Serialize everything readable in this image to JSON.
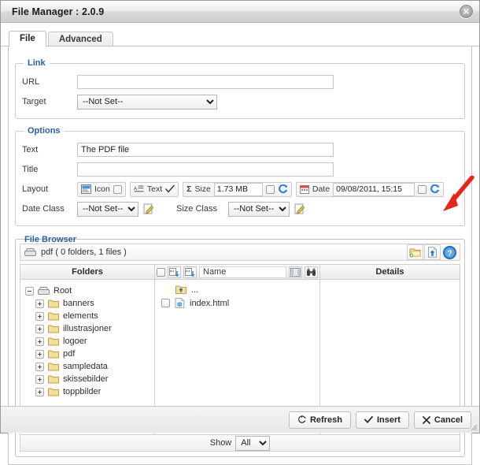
{
  "window": {
    "title": "File Manager : 2.0.9",
    "close_icon": "close-circle-icon"
  },
  "tabs": [
    {
      "label": "File",
      "active": true
    },
    {
      "label": "Advanced",
      "active": false
    }
  ],
  "link_section": {
    "legend": "Link",
    "url_label": "URL",
    "url_value": "",
    "target_label": "Target",
    "target_value": "--Not Set--",
    "target_options": [
      "--Not Set--"
    ]
  },
  "options_section": {
    "legend": "Options",
    "text_label": "Text",
    "text_value": "The PDF file",
    "title_label": "Title",
    "title_value": "",
    "layout_label": "Layout",
    "layout": {
      "icon_label": "Icon",
      "icon_checked": false,
      "text_label": "Text",
      "text_checked": true,
      "size_label": "Size",
      "size_value": "1.73 MB",
      "size_checked": false,
      "size_refresh_icon": "refresh-icon",
      "date_label": "Date",
      "date_value": "09/08/2011, 15:15",
      "date_checked": false,
      "date_refresh_icon": "refresh-icon"
    },
    "date_class_label": "Date Class",
    "date_class_value": "--Not Set--",
    "date_class_edit_icon": "edit-pencil-icon",
    "size_class_label": "Size Class",
    "size_class_value": "--Not Set--",
    "size_class_edit_icon": "edit-pencil-icon",
    "class_options": [
      "--Not Set--"
    ]
  },
  "file_browser": {
    "legend": "File Browser",
    "path_icon": "drive-icon",
    "path_text": "pdf ( 0 folders, 1 files )",
    "toolbar_buttons": [
      {
        "name": "new-folder-button",
        "icon": "folder-add-icon"
      },
      {
        "name": "upload-button",
        "icon": "upload-icon"
      },
      {
        "name": "help-button",
        "icon": "help-icon"
      }
    ],
    "folders_header": "Folders",
    "name_header": "Name",
    "details_header": "Details",
    "name_tools": {
      "select_all_icon": "checkbox-icon",
      "sort_az_icon": "sort-az-icon",
      "sort_za_icon": "sort-az-icon",
      "view_toggle_icon": "list-view-icon",
      "search_icon": "binoculars-icon"
    },
    "tree": [
      {
        "label": "Root",
        "icon": "drive-icon",
        "expander": "minus",
        "level": 0
      },
      {
        "label": "banners",
        "icon": "folder-icon",
        "expander": "plus",
        "level": 1
      },
      {
        "label": "elements",
        "icon": "folder-icon",
        "expander": "plus",
        "level": 1
      },
      {
        "label": "illustrasjoner",
        "icon": "folder-icon",
        "expander": "plus",
        "level": 1
      },
      {
        "label": "logoer",
        "icon": "folder-icon",
        "expander": "plus",
        "level": 1
      },
      {
        "label": "pdf",
        "icon": "folder-icon",
        "expander": "plus",
        "level": 1
      },
      {
        "label": "sampledata",
        "icon": "folder-icon",
        "expander": "plus",
        "level": 1
      },
      {
        "label": "skissebilder",
        "icon": "folder-icon",
        "expander": "plus",
        "level": 1
      },
      {
        "label": "toppbilder",
        "icon": "folder-icon",
        "expander": "plus",
        "level": 1
      }
    ],
    "files": [
      {
        "label": "...",
        "icon": "folder-up-icon",
        "checkbox": false
      },
      {
        "label": "index.html",
        "icon": "html-file-icon",
        "checkbox": true
      }
    ],
    "show_label": "Show",
    "show_value": "All",
    "show_options": [
      "All"
    ]
  },
  "footer": {
    "refresh_label": "Refresh",
    "refresh_icon": "refresh-circle-icon",
    "insert_label": "Insert",
    "insert_icon": "check-icon",
    "cancel_label": "Cancel",
    "cancel_icon": "x-icon",
    "resize_grip_icon": "resize-grip-icon"
  },
  "annotation": {
    "arrow_icon": "red-arrow-icon",
    "color": "#e8251b",
    "points_at": "upload-button"
  },
  "colors": {
    "accent": "#2b5fa8",
    "annotation": "#e8251b",
    "folder": "#f5d78e"
  }
}
